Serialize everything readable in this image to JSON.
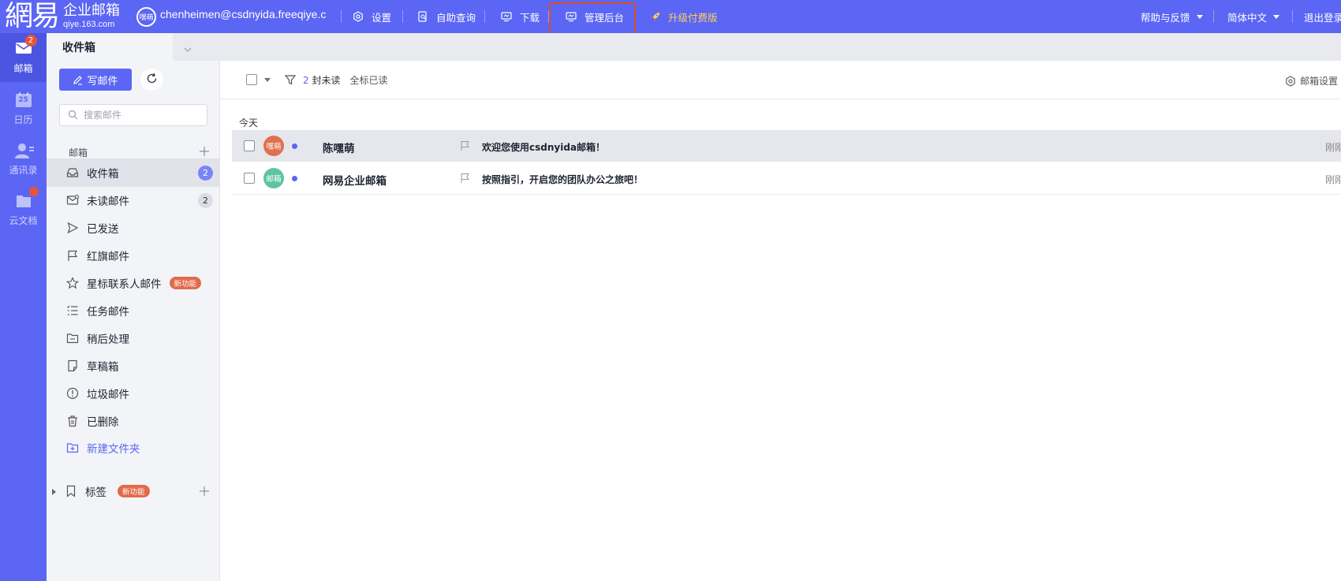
{
  "app": {
    "logo_mark": "網易",
    "logo_title": "企业邮箱",
    "logo_domain": "qiye.163.com",
    "avatar_initials": "嘿萌",
    "account_email": "chenheimen@csdnyida.freeqiye.com"
  },
  "nav": {
    "settings": "设置",
    "self_query": "自助查询",
    "download": "下载",
    "admin": "管理后台",
    "upgrade": "升级付费版",
    "help": "帮助与反馈",
    "language": "简体中文",
    "logout": "退出登录"
  },
  "rail": {
    "mail": "邮箱",
    "mail_badge": "2",
    "calendar": "日历",
    "calendar_day": "25",
    "contacts": "通讯录",
    "docs": "云文档"
  },
  "tab": {
    "label": "收件箱"
  },
  "panel": {
    "compose": "写邮件",
    "search_placeholder": "搜索邮件",
    "section_label": "邮箱",
    "folders": [
      {
        "label": "收件箱",
        "count": "2",
        "icon": "inbox-icon"
      },
      {
        "label": "未读邮件",
        "count": "2",
        "icon": "unread-mail-icon"
      },
      {
        "label": "已发送",
        "icon": "send-icon"
      },
      {
        "label": "红旗邮件",
        "icon": "flag-icon"
      },
      {
        "label": "星标联系人邮件",
        "badge": "新功能",
        "icon": "star-icon"
      },
      {
        "label": "任务邮件",
        "icon": "task-list-icon"
      },
      {
        "label": "稍后处理",
        "icon": "folder-icon"
      },
      {
        "label": "草稿箱",
        "icon": "draft-icon"
      },
      {
        "label": "垃圾邮件",
        "icon": "spam-icon"
      },
      {
        "label": "已删除",
        "icon": "trash-icon"
      }
    ],
    "new_folder": "新建文件夹",
    "tags_label": "标签",
    "tags_badge": "新功能"
  },
  "toolbar": {
    "unread_count": "2",
    "unread_label": "封未读",
    "mark_all_read": "全标已读",
    "mailbox_settings": "邮箱设置"
  },
  "list": {
    "group_label": "今天",
    "messages": [
      {
        "avatar": "嘿萌",
        "avatar_color": "#e0704e",
        "sender": "陈嘿萌",
        "subject": "欢迎您使用csdnyida邮箱！",
        "time": "刚刚",
        "unread": true
      },
      {
        "avatar": "邮箱",
        "avatar_color": "#5fc4a0",
        "sender": "网易企业邮箱",
        "subject": "按照指引，开启您的团队办公之旅吧！",
        "time": "刚刚",
        "unread": true
      }
    ]
  },
  "colors": {
    "brand": "#5b66f4",
    "upgrade": "#ffd15a",
    "highlight": "#d94b2b",
    "badge_red": "#e5553b"
  }
}
